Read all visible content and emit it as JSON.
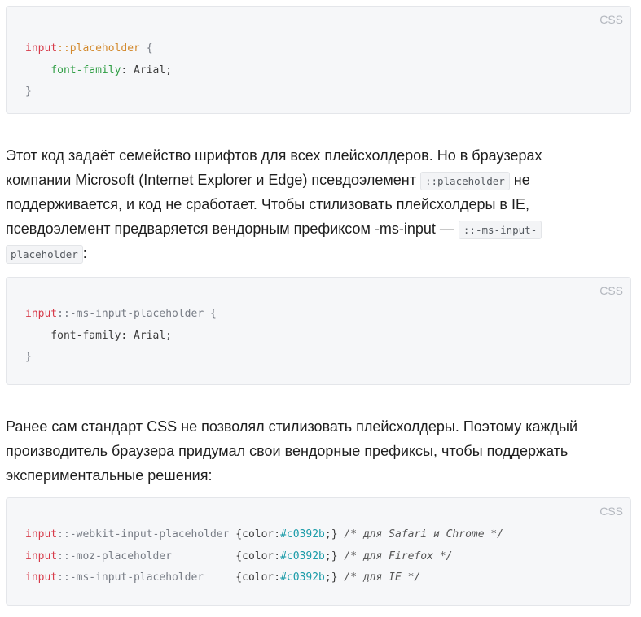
{
  "block1": {
    "lang": "CSS",
    "line1": {
      "selector": "input",
      "pseudo": "::placeholder",
      "brace": " {"
    },
    "line2": {
      "indent": "    ",
      "prop": "font-family",
      "rest": ": Arial;"
    },
    "line3": "}"
  },
  "para1": {
    "l1": "Этот код задаёт семейство шрифтов для всех плейсхолдеров. Но в браузерах",
    "l2a": "компании Microsoft (Internet Explorer и Edge) псевдоэлемент ",
    "l2code": "::placeholder",
    "l2b": " не",
    "l3": "поддерживается, и код не сработает. Чтобы стилизовать плейсхолдеры в IE,",
    "l4a": "псевдоэлемент предваряется вендорным префиксом -ms-input — ",
    "l4code": "::-ms-input-",
    "l5code": "placeholder",
    "l5b": ":"
  },
  "block2": {
    "lang": "CSS",
    "line1": {
      "selector": "input",
      "rest": "::-ms-input-placeholder {"
    },
    "line2": "    font-family: Arial;",
    "line3": "}"
  },
  "para2": {
    "l1": "Ранее сам стандарт CSS не позволял стилизовать плейсхолдеры. Поэтому каждый",
    "l2": "производитель браузера придумал свои вендорные префиксы, чтобы поддержать",
    "l3": "экспериментальные решения:"
  },
  "block3": {
    "lang": "CSS",
    "rows": [
      {
        "selector": "input",
        "pseudo": "::-webkit-input-placeholder ",
        "open": "{color:",
        "hex": "#c0392b",
        "close": ";}",
        "comment": " /* для Safari и Chrome */"
      },
      {
        "selector": "input",
        "pseudo": "::-moz-placeholder          ",
        "open": "{color:",
        "hex": "#c0392b",
        "close": ";}",
        "comment": " /* для Firefox */"
      },
      {
        "selector": "input",
        "pseudo": "::-ms-input-placeholder     ",
        "open": "{color:",
        "hex": "#c0392b",
        "close": ";}",
        "comment": " /* для IE */"
      }
    ]
  },
  "colors": {
    "selector": "#d73a49",
    "pseudo": "#d38a2e",
    "property": "#2f9e44",
    "hex": "#1a9ba8"
  }
}
